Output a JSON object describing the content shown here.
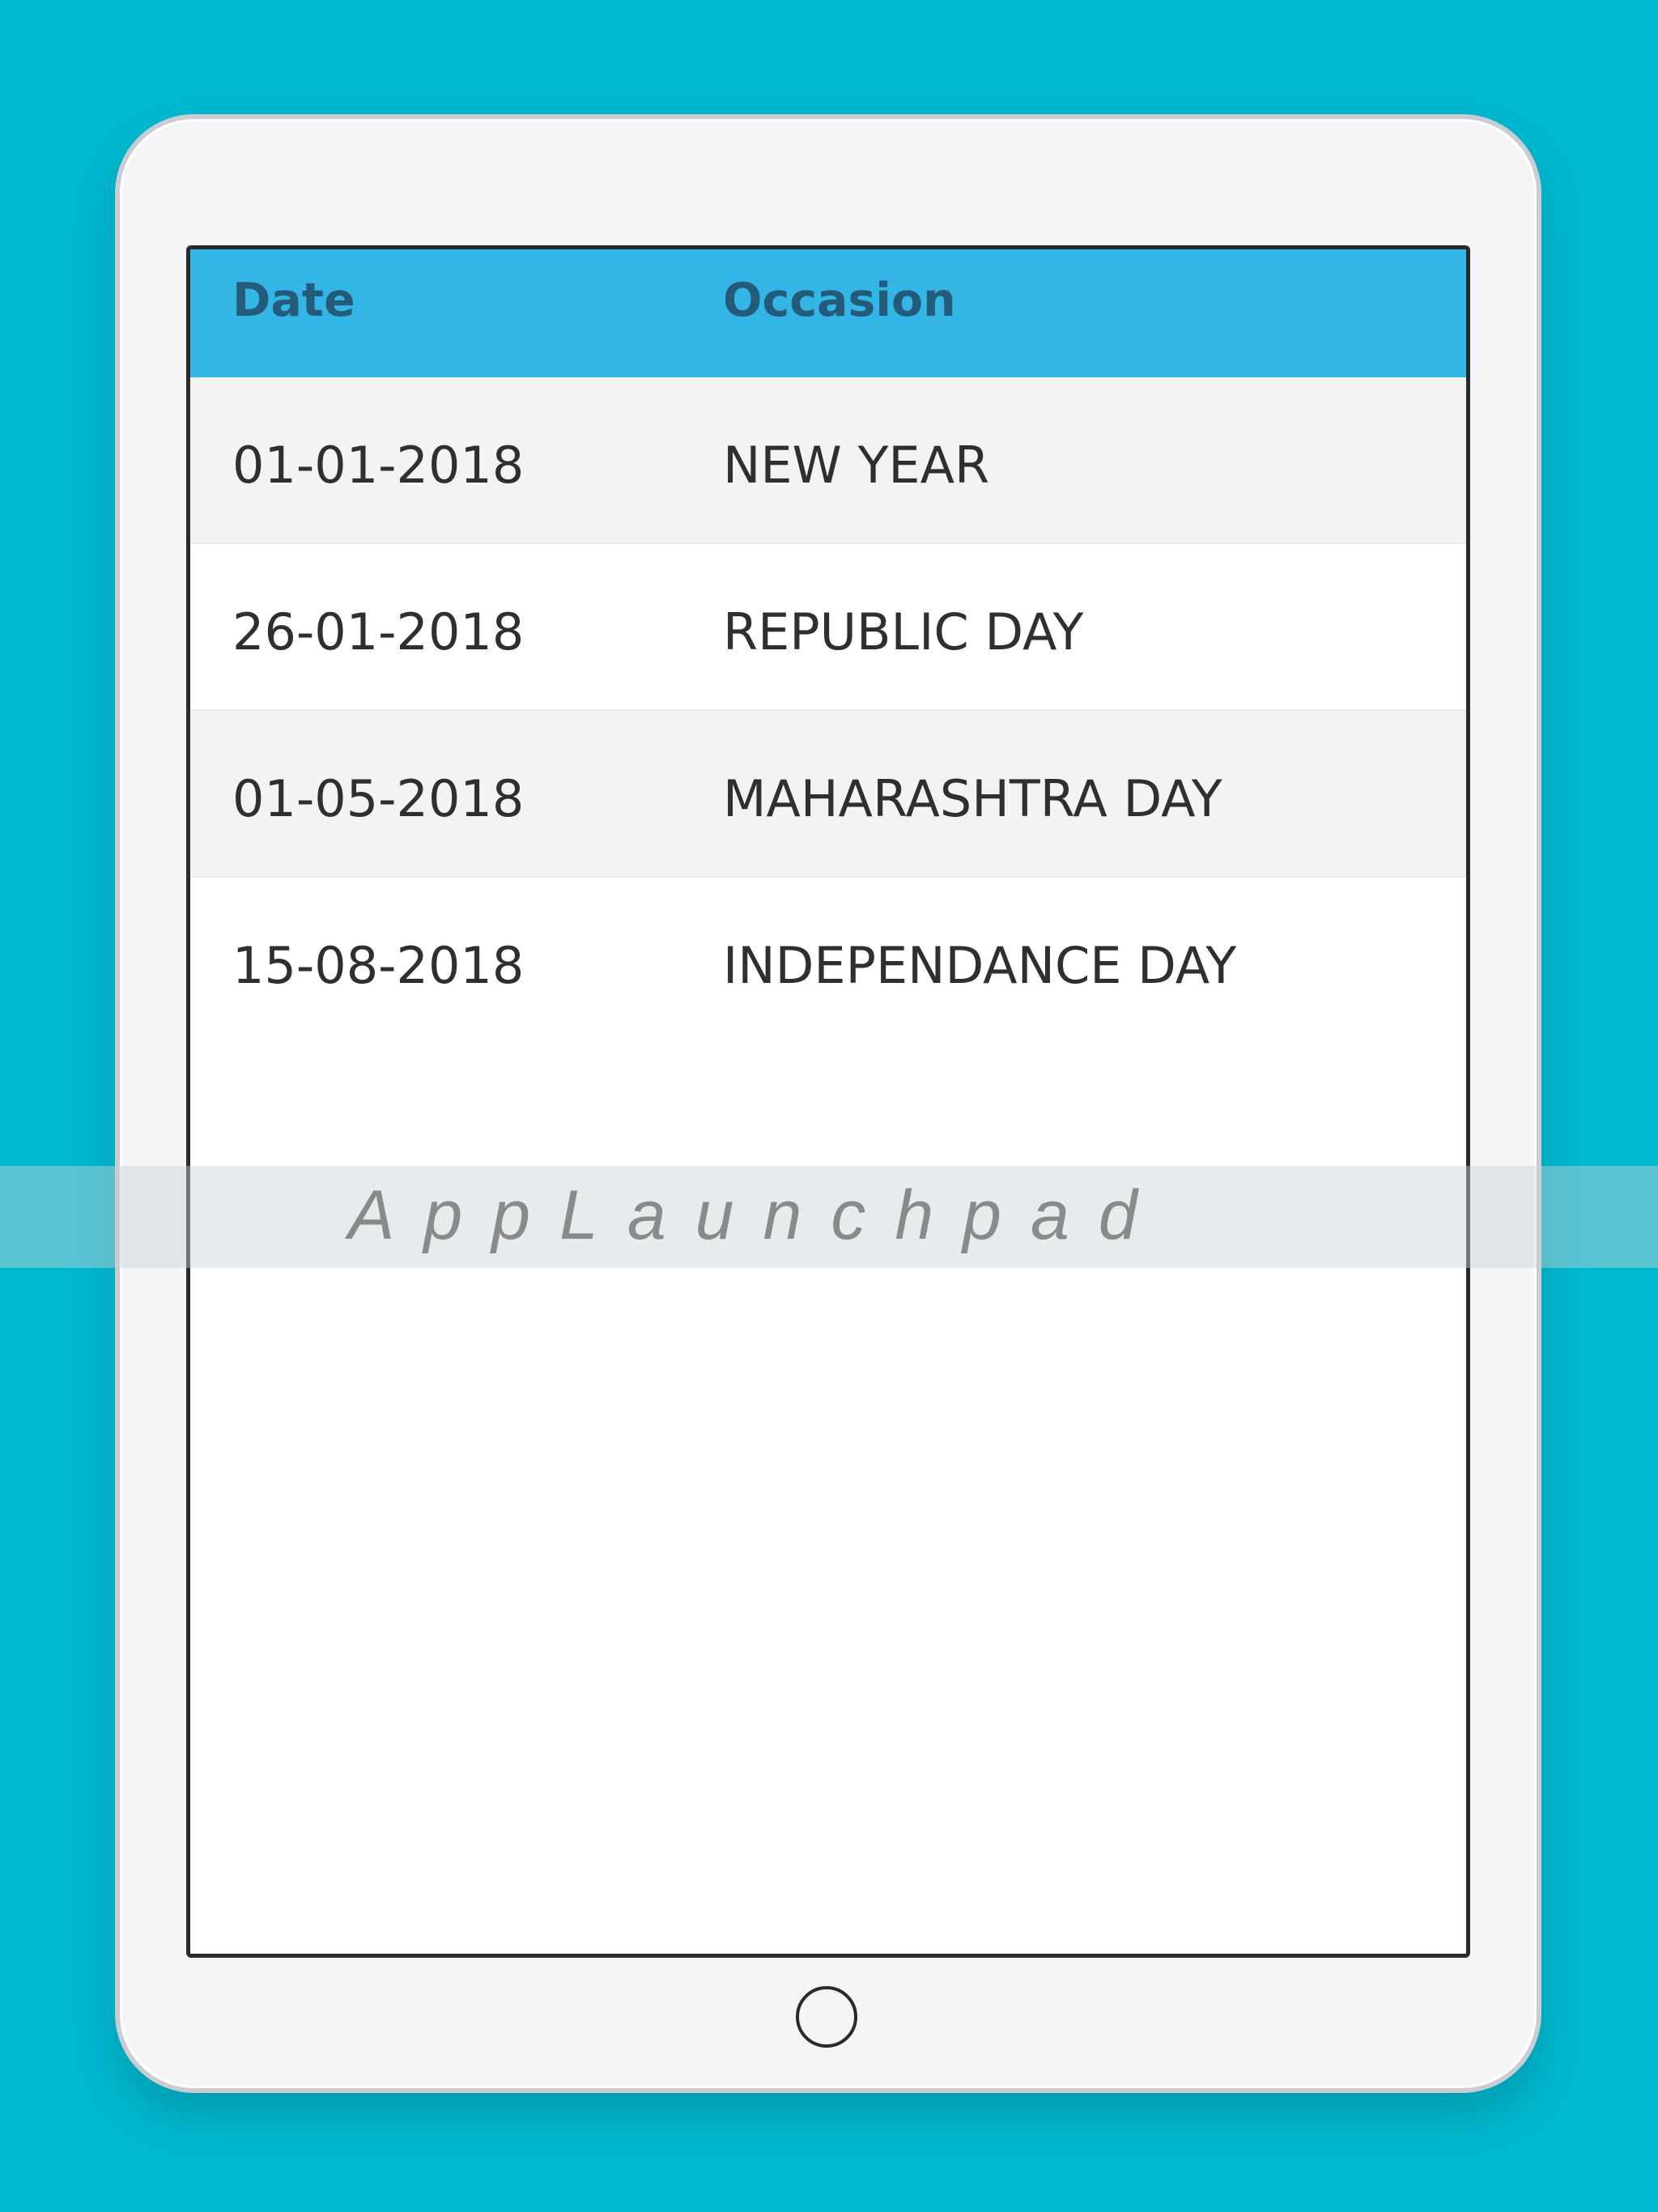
{
  "table": {
    "headers": {
      "date": "Date",
      "occasion": "Occasion"
    },
    "rows": [
      {
        "date": "01-01-2018",
        "occasion": "NEW YEAR"
      },
      {
        "date": "26-01-2018",
        "occasion": "REPUBLIC DAY"
      },
      {
        "date": "01-05-2018",
        "occasion": "MAHARASHTRA DAY"
      },
      {
        "date": "15-08-2018",
        "occasion": "INDEPENDANCE DAY"
      }
    ]
  },
  "watermark": {
    "text": "AppLaunchpad"
  },
  "colors": {
    "background": "#00b8d0",
    "header": "#33b5e5",
    "header_text": "#245a7a",
    "row_alt": "#f3f3f3"
  },
  "icons": {
    "camera": "camera-icon",
    "home": "home-button-icon"
  }
}
